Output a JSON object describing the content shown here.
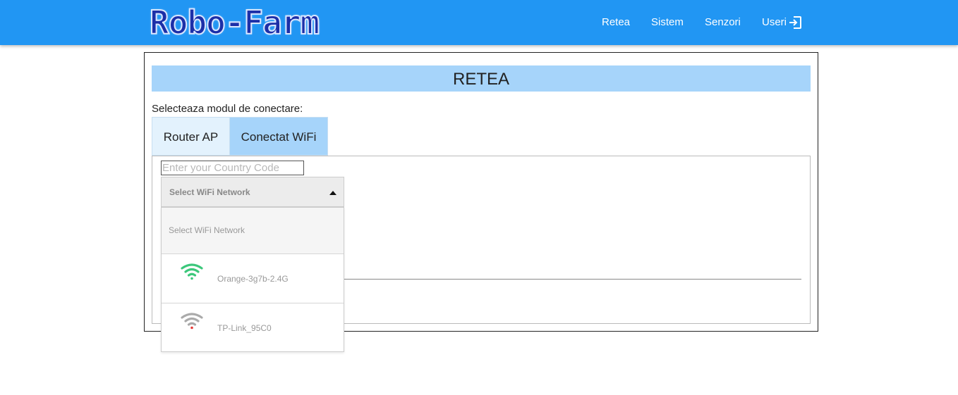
{
  "header": {
    "logo_text": "Robo-Farm",
    "nav": [
      "Retea",
      "Sistem",
      "Senzori",
      "Useri"
    ],
    "logout_icon": "logout-icon"
  },
  "page": {
    "title": "RETEA",
    "select_label": "Selecteaza modul de conectare:",
    "tabs": [
      {
        "label": "Router AP",
        "active": false
      },
      {
        "label": "Conectat WiFi",
        "active": true
      }
    ],
    "country_code": {
      "value": "",
      "placeholder": "Enter your Country Code"
    },
    "wifi_dropdown": {
      "selected": "Select WiFi Network",
      "options": [
        {
          "label": "Select WiFi Network"
        },
        {
          "label": "Orange-3g7b-2.4G",
          "icon": "wifi-strong-icon",
          "color": "#3cc77b"
        },
        {
          "label": "TP-Link_95C0",
          "icon": "wifi-weak-icon",
          "color": "#aaaaaa",
          "dot_color": "#e53935"
        }
      ]
    }
  },
  "colors": {
    "header_bg": "#2196f3",
    "title_bg": "#a6d4fa",
    "tab_active_bg": "#a6d4fa",
    "tab_inactive_bg": "#e3f2fd"
  }
}
